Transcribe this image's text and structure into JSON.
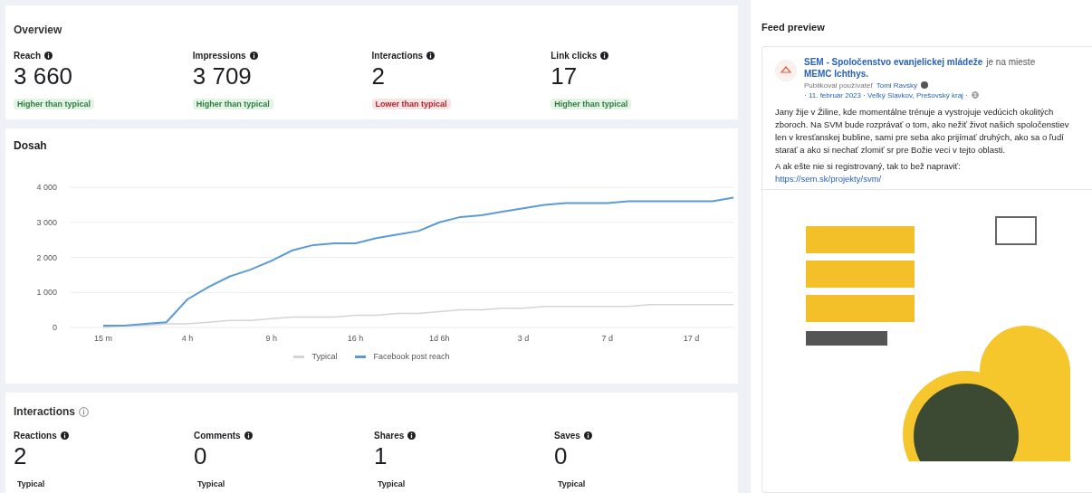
{
  "overview": {
    "title": "Overview",
    "metrics": [
      {
        "label": "Reach",
        "value": "3 660",
        "badge": "Higher than typical",
        "kind": "higher"
      },
      {
        "label": "Impressions",
        "value": "3 709",
        "badge": "Higher than typical",
        "kind": "higher"
      },
      {
        "label": "Interactions",
        "value": "2",
        "badge": "Lower than typical",
        "kind": "lower"
      },
      {
        "label": "Link clicks",
        "value": "17",
        "badge": "Higher than typical",
        "kind": "higher"
      }
    ]
  },
  "reach_chart": {
    "title": "Dosah",
    "chart_data": {
      "type": "line",
      "categories": [
        "15 m",
        null,
        null,
        null,
        "4 h",
        null,
        null,
        null,
        "9 h",
        null,
        null,
        null,
        "16 h",
        null,
        null,
        null,
        "1d 6h",
        null,
        null,
        null,
        "3 d",
        null,
        null,
        null,
        "7 d",
        null,
        null,
        null,
        "17 d",
        null,
        null
      ],
      "series": [
        {
          "name": "Typical",
          "color": "#d4d4d4",
          "values": [
            0,
            50,
            50,
            100,
            100,
            150,
            200,
            200,
            250,
            300,
            300,
            300,
            350,
            350,
            400,
            400,
            450,
            500,
            500,
            550,
            550,
            600,
            600,
            600,
            600,
            600,
            650,
            650,
            650,
            650,
            650
          ]
        },
        {
          "name": "Facebook post reach",
          "color": "#5b9bd5",
          "values": [
            50,
            50,
            100,
            150,
            800,
            1150,
            1450,
            1650,
            1900,
            2200,
            2350,
            2400,
            2400,
            2550,
            2650,
            2750,
            3000,
            3150,
            3200,
            3300,
            3400,
            3500,
            3550,
            3550,
            3550,
            3600,
            3600,
            3600,
            3600,
            3600,
            3700
          ]
        }
      ],
      "ylim": [
        0,
        4000
      ],
      "grid": true,
      "yticks": [
        {
          "value": 0,
          "label": "0"
        },
        {
          "value": 1000,
          "label": "1 000"
        },
        {
          "value": 2000,
          "label": "2 000"
        },
        {
          "value": 3000,
          "label": "3 000"
        },
        {
          "value": 4000,
          "label": "4 000"
        }
      ],
      "stacked": false
    }
  },
  "interactions": {
    "title": "Interactions",
    "metrics": [
      {
        "label": "Reactions",
        "value": "2",
        "badge": "Typical"
      },
      {
        "label": "Comments",
        "value": "0",
        "badge": "Typical"
      },
      {
        "label": "Shares",
        "value": "1",
        "badge": "Typical"
      },
      {
        "label": "Saves",
        "value": "0",
        "badge": "Typical"
      }
    ]
  },
  "feed_preview": {
    "title": "Feed preview",
    "post": {
      "author": "SEM - Spoločenstvo evanjelickej mládeže",
      "connector": "je na mieste",
      "place": "MEMC Ichthys.",
      "meta_prefix": "Publikoval používateľ",
      "publisher": "Tomi Ravský",
      "meta_details": "· 11. február 2023 · Veľký Slavkov, Prešovský kraj ·",
      "body": "Jany žije v Žiline, kde momentálne trénuje a vystrojuje vedúcich okolitých zboroch. Na SVM bude rozprávať o tom, ako nežiť život našich spoločenstiev len v kresťanskej bubline, sami pre seba ako prijímať druhých, ako sa o ľudí starať a ako si nechať zlomiť sr pre Božie veci v tejto oblasti.",
      "cta": "A ak ešte nie si registrovaný, tak to bež napraviť:",
      "link": "https://sem.sk/projekty/svm/"
    }
  }
}
